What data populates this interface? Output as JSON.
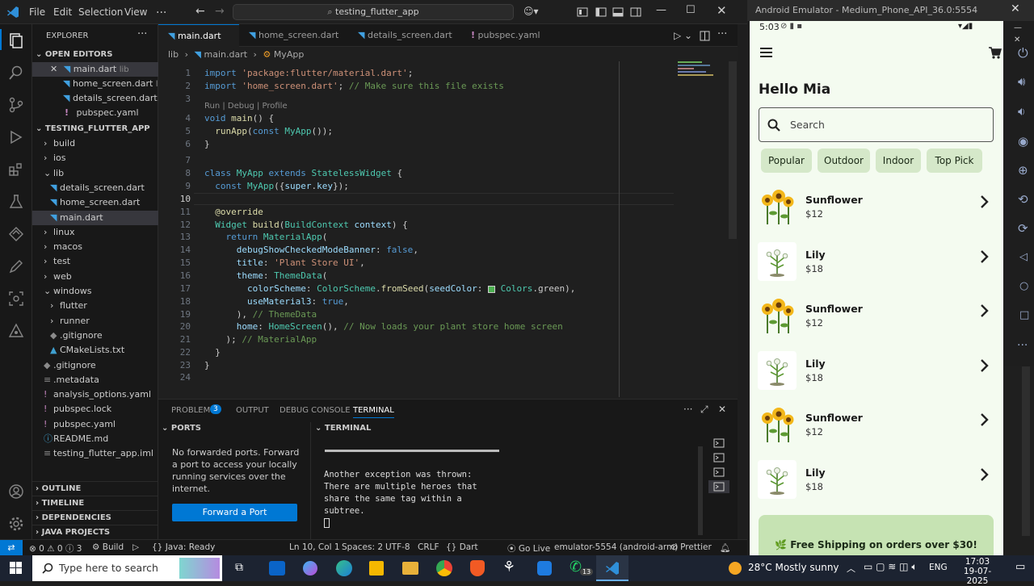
{
  "titlebar": {
    "menus": [
      "File",
      "Edit",
      "Selection",
      "View"
    ],
    "more": "...",
    "search": "testing_flutter_app"
  },
  "sidebar": {
    "title": "EXPLORER",
    "open_editors_label": "OPEN EDITORS",
    "open_editors": [
      {
        "name": "main.dart",
        "hint": "lib"
      },
      {
        "name": "home_screen.dart",
        "hint": "lib"
      },
      {
        "name": "details_screen.dart...",
        "hint": ""
      },
      {
        "name": "pubspec.yaml",
        "hint": ""
      }
    ],
    "project_label": "TESTING_FLUTTER_APP",
    "tree": [
      {
        "name": "build",
        "type": "folder",
        "indent": 1
      },
      {
        "name": "ios",
        "type": "folder",
        "indent": 1
      },
      {
        "name": "lib",
        "type": "folder-open",
        "indent": 1
      },
      {
        "name": "details_screen.dart",
        "type": "dart",
        "indent": 2
      },
      {
        "name": "home_screen.dart",
        "type": "dart",
        "indent": 2
      },
      {
        "name": "main.dart",
        "type": "dart",
        "indent": 2
      },
      {
        "name": "linux",
        "type": "folder",
        "indent": 1
      },
      {
        "name": "macos",
        "type": "folder",
        "indent": 1
      },
      {
        "name": "test",
        "type": "folder",
        "indent": 1
      },
      {
        "name": "web",
        "type": "folder",
        "indent": 1
      },
      {
        "name": "windows",
        "type": "folder-open",
        "indent": 1
      },
      {
        "name": "flutter",
        "type": "folder",
        "indent": 2
      },
      {
        "name": "runner",
        "type": "folder",
        "indent": 2
      },
      {
        "name": ".gitignore",
        "type": "git",
        "indent": 2
      },
      {
        "name": "CMakeLists.txt",
        "type": "cmake",
        "indent": 2
      },
      {
        "name": ".gitignore",
        "type": "git",
        "indent": 1
      },
      {
        "name": ".metadata",
        "type": "file",
        "indent": 1
      },
      {
        "name": "analysis_options.yaml",
        "type": "yaml",
        "indent": 1
      },
      {
        "name": "pubspec.lock",
        "type": "yaml",
        "indent": 1
      },
      {
        "name": "pubspec.yaml",
        "type": "yaml",
        "indent": 1
      },
      {
        "name": "README.md",
        "type": "info",
        "indent": 1
      },
      {
        "name": "testing_flutter_app.iml",
        "type": "file",
        "indent": 1
      }
    ],
    "bottom_sections": [
      "OUTLINE",
      "TIMELINE",
      "DEPENDENCIES",
      "JAVA PROJECTS"
    ]
  },
  "tabs": [
    {
      "label": "main.dart",
      "active": true
    },
    {
      "label": "home_screen.dart",
      "active": false
    },
    {
      "label": "details_screen.dart",
      "active": false
    },
    {
      "label": "pubspec.yaml",
      "active": false
    }
  ],
  "breadcrumb": [
    "lib",
    "main.dart",
    "MyApp"
  ],
  "codelens": "Run | Debug | Profile",
  "code_lines": [
    {
      "n": "1",
      "t": "import 'package:flutter/material.dart';"
    },
    {
      "n": "2",
      "t": "import 'home_screen.dart'; // Make sure this file exists"
    },
    {
      "n": "3",
      "t": ""
    },
    {
      "n": "4",
      "t": "void main() {"
    },
    {
      "n": "5",
      "t": "  runApp(const MyApp());"
    },
    {
      "n": "6",
      "t": "}"
    },
    {
      "n": "7",
      "t": ""
    },
    {
      "n": "8",
      "t": "class MyApp extends StatelessWidget {"
    },
    {
      "n": "9",
      "t": "  const MyApp({super.key});"
    },
    {
      "n": "10",
      "t": ""
    },
    {
      "n": "11",
      "t": "  @override"
    },
    {
      "n": "12",
      "t": "  Widget build(BuildContext context) {"
    },
    {
      "n": "13",
      "t": "    return MaterialApp("
    },
    {
      "n": "14",
      "t": "      debugShowCheckedModeBanner: false,"
    },
    {
      "n": "15",
      "t": "      title: 'Plant Store UI',"
    },
    {
      "n": "16",
      "t": "      theme: ThemeData("
    },
    {
      "n": "17",
      "t": "        colorScheme: ColorScheme.fromSeed(seedColor:   Colors.green),"
    },
    {
      "n": "18",
      "t": "        useMaterial3: true,"
    },
    {
      "n": "19",
      "t": "      ), // ThemeData"
    },
    {
      "n": "20",
      "t": "      home: HomeScreen(), // Now loads your plant store home screen"
    },
    {
      "n": "21",
      "t": "    ); // MaterialApp"
    },
    {
      "n": "22",
      "t": "  }"
    },
    {
      "n": "23",
      "t": "}"
    },
    {
      "n": "24",
      "t": ""
    }
  ],
  "panel": {
    "tabs": [
      "PROBLEMS",
      "OUTPUT",
      "DEBUG CONSOLE",
      "TERMINAL"
    ],
    "problems_count": "3",
    "ports_label": "PORTS",
    "ports_text": "No forwarded ports. Forward a port to access your locally running services over the internet.",
    "forward_button": "Forward a Port",
    "terminal_label": "TERMINAL",
    "terminal_lines": [
      "Another exception was thrown:",
      "There are multiple heroes that",
      "share the same tag within a",
      "subtree."
    ]
  },
  "statusbar": {
    "errors": "0",
    "warnings": "0",
    "info": "3",
    "build": "Build",
    "java": "Java: Ready",
    "position": "Ln 10, Col 1",
    "spaces": "Spaces: 2",
    "encoding": "UTF-8",
    "eol": "CRLF",
    "language": "Dart",
    "golive": "Go Live",
    "device": "emulator-5554 (android-arm)",
    "prettier": "Prettier"
  },
  "emulator": {
    "title": "Android Emulator - Medium_Phone_API_36.0:5554",
    "time": "5:03",
    "greeting": "Hello Mia",
    "search_placeholder": "Search",
    "chips": [
      "Popular",
      "Outdoor",
      "Indoor",
      "Top Pick"
    ],
    "plants": [
      {
        "name": "Sunflower",
        "price": "$12",
        "kind": "sunflower"
      },
      {
        "name": "Lily",
        "price": "$18",
        "kind": "lily"
      },
      {
        "name": "Sunflower",
        "price": "$12",
        "kind": "sunflower"
      },
      {
        "name": "Lily",
        "price": "$18",
        "kind": "lily"
      },
      {
        "name": "Sunflower",
        "price": "$12",
        "kind": "sunflower"
      },
      {
        "name": "Lily",
        "price": "$18",
        "kind": "lily"
      }
    ],
    "banner": "🌿 Free Shipping on orders over $30!"
  },
  "taskbar": {
    "search_placeholder": "Type here to search",
    "weather": "28°C  Mostly sunny",
    "lang": "ENG",
    "time": "17:03",
    "date": "19-07-2025",
    "whatsapp_badge": "13"
  },
  "colors": {
    "accent": "#0078d4",
    "phone_bg": "#f4fbf0",
    "chip_bg": "#d5e8c9",
    "banner_bg": "#c6e3b3"
  }
}
